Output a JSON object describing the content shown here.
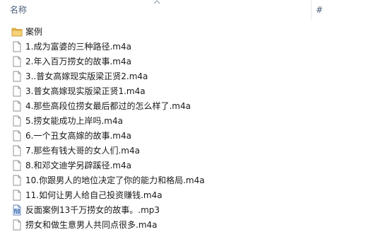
{
  "header": {
    "name_label": "名称",
    "number_label": "#"
  },
  "files": [
    {
      "name": "案例",
      "type": "folder"
    },
    {
      "name": "1.成为富婆的三种路径.m4a",
      "type": "file"
    },
    {
      "name": "2.年入百万捞女的故事.m4a",
      "type": "file"
    },
    {
      "name": "3..普女高嫁现实版梁正贤2.m4a",
      "type": "file"
    },
    {
      "name": "3.普女高嫁现实版梁正贤1.m4a",
      "type": "file"
    },
    {
      "name": "4.那些高段位捞女最后都过的怎么样了.m4a",
      "type": "file"
    },
    {
      "name": "5.捞女能成功上岸吗.m4a",
      "type": "file"
    },
    {
      "name": "6.一个丑女高嫁的故事.m4a",
      "type": "file"
    },
    {
      "name": "7.那些有钱大哥的女人们.m4a",
      "type": "file"
    },
    {
      "name": "8.和邓文迪学另辟蹊径.m4a",
      "type": "file"
    },
    {
      "name": "10.你跟男人的地位决定了你的能力和格局.m4a",
      "type": "file"
    },
    {
      "name": "11.如何让男人给自己投资赚钱.m4a",
      "type": "file"
    },
    {
      "name": "反面案例13千万捞女的故事。.mp3",
      "type": "audio"
    },
    {
      "name": "捞女和做生意男人共同点很多.m4a",
      "type": "file"
    }
  ]
}
